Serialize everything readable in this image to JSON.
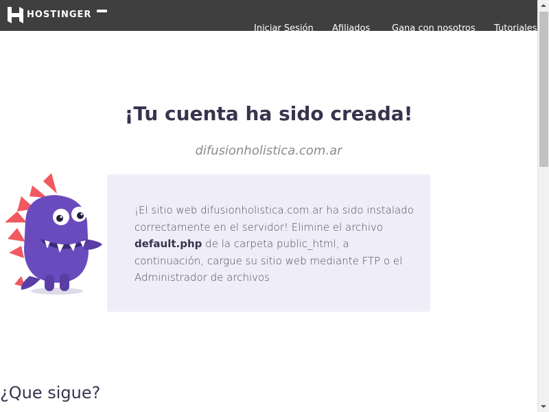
{
  "header": {
    "logo_text": "HOSTINGER",
    "nav": [
      {
        "label": "Iniciar Sesión"
      },
      {
        "label": "Afiliados"
      },
      {
        "label": "Gana con nosotros"
      },
      {
        "label": "Tutoriales"
      }
    ],
    "colors": {
      "background": "#3f3f3f",
      "text": "#ffffff"
    }
  },
  "main": {
    "title": "¡Tu cuenta ha sido creada!",
    "domain": "difusionholistica.com.ar",
    "notice": {
      "part1": "¡El sitio web difusionholistica.com.ar ha sido instalado correctamente en el servidor! Elimine el archivo ",
      "filename": "default.php",
      "part2": " de la carpeta public_html, a continuación, cargue su sitio web mediante FTP o el Administrador de archivos"
    },
    "next_heading": "¿Que sigue?",
    "colors": {
      "title": "#36344d",
      "box": "#efeef8",
      "mascot": "#6a4bbd",
      "mascot_spikes": "#f0595f"
    }
  },
  "scrollbar": {
    "thumb_color": "#c1c1c1"
  }
}
